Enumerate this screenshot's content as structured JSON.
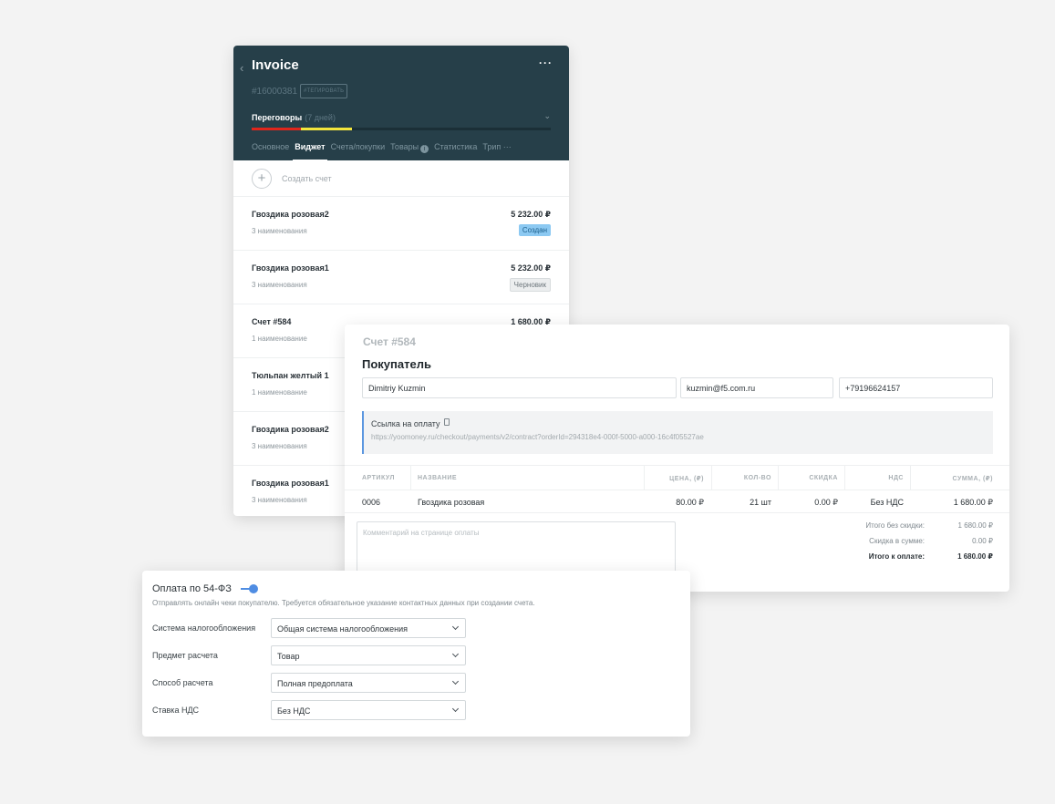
{
  "invoice_panel": {
    "back_icon": "chevron-left",
    "title": "Invoice",
    "more": "···",
    "id": "#16000381",
    "tag": "#ТЕГИРОВАТЬ",
    "stage": {
      "name": "Переговоры",
      "days": "(7 дней)"
    },
    "colors": {
      "header": "#263f49",
      "progress_red": "#e0261c",
      "progress_yellow": "#f3e53c"
    },
    "tabs": [
      {
        "label": "Основное",
        "active": false
      },
      {
        "label": "Виджет",
        "active": true
      },
      {
        "label": "Счета/покупки",
        "active": false
      },
      {
        "label": "Товары",
        "active": false,
        "has_info": true
      },
      {
        "label": "Статистика",
        "active": false
      },
      {
        "label": "Трип ···",
        "active": false
      }
    ],
    "info_glyph": "i",
    "create_label": "Создать счет",
    "items": [
      {
        "name": "Гвоздика розовая2",
        "sub": "3 наименования",
        "price": "5 232.00 ₽",
        "status": "Создан",
        "status_type": "created"
      },
      {
        "name": "Гвоздика розовая1",
        "sub": "3 наименования",
        "price": "5 232.00 ₽",
        "status": "Черновик",
        "status_type": "draft"
      },
      {
        "name": "Счет #584",
        "sub": "1 наименование",
        "price": "1 680.00 ₽",
        "status": "",
        "status_type": ""
      },
      {
        "name": "Тюльпан желтый 1",
        "sub": "1 наименование",
        "price": "",
        "status": "",
        "status_type": ""
      },
      {
        "name": "Гвоздика розовая2",
        "sub": "3 наименования",
        "price": "",
        "status": "",
        "status_type": ""
      },
      {
        "name": "Гвоздика розовая1",
        "sub": "3 наименования",
        "price": "",
        "status": "",
        "status_type": ""
      }
    ]
  },
  "detail": {
    "subtitle": "Счет #584",
    "title": "Покупатель",
    "buyer_name": "Dimitriy Kuzmin",
    "buyer_email": "kuzmin@f5.com.ru",
    "buyer_phone": "+79196624157",
    "paylink_label": "Ссылка на оплату",
    "paylink_url": "https://yoomoney.ru/checkout/payments/v2/contract?orderId=294318e4-000f-5000-a000-16c4f05527ae",
    "columns": [
      "АРТИКУЛ",
      "НАЗВАНИЕ",
      "ЦЕНА, (₽)",
      "КОЛ-ВО",
      "СКИДКА",
      "НДС",
      "СУММА, (₽)"
    ],
    "rows": [
      {
        "sku": "0006",
        "name": "Гвоздика розовая",
        "price": "80.00 ₽",
        "qty": "21 шт",
        "discount": "0.00 ₽",
        "vat": "Без НДС",
        "sum": "1 680.00 ₽"
      }
    ],
    "comment_placeholder": "Комментарий на странице оплаты",
    "totals": [
      {
        "label": "Итого без скидки:",
        "value": "1 680.00 ₽"
      },
      {
        "label": "Скидка в сумме:",
        "value": "0.00 ₽"
      },
      {
        "label": "Итого к оплате:",
        "value": "1 680.00 ₽"
      }
    ],
    "accent": "#5b97e0"
  },
  "fz": {
    "title": "Оплата по 54-ФЗ",
    "toggle_on": true,
    "toggle_color": "#4f8de3",
    "description": "Отправлять онлайн чеки покупателю. Требуется обязательное указание контактных данных при создании счета.",
    "fields": [
      {
        "label": "Система налогообложения",
        "value": "Общая система налогообложения"
      },
      {
        "label": "Предмет расчета",
        "value": "Товар"
      },
      {
        "label": "Способ расчета",
        "value": "Полная предоплата"
      },
      {
        "label": "Ставка НДС",
        "value": "Без НДС"
      }
    ]
  }
}
